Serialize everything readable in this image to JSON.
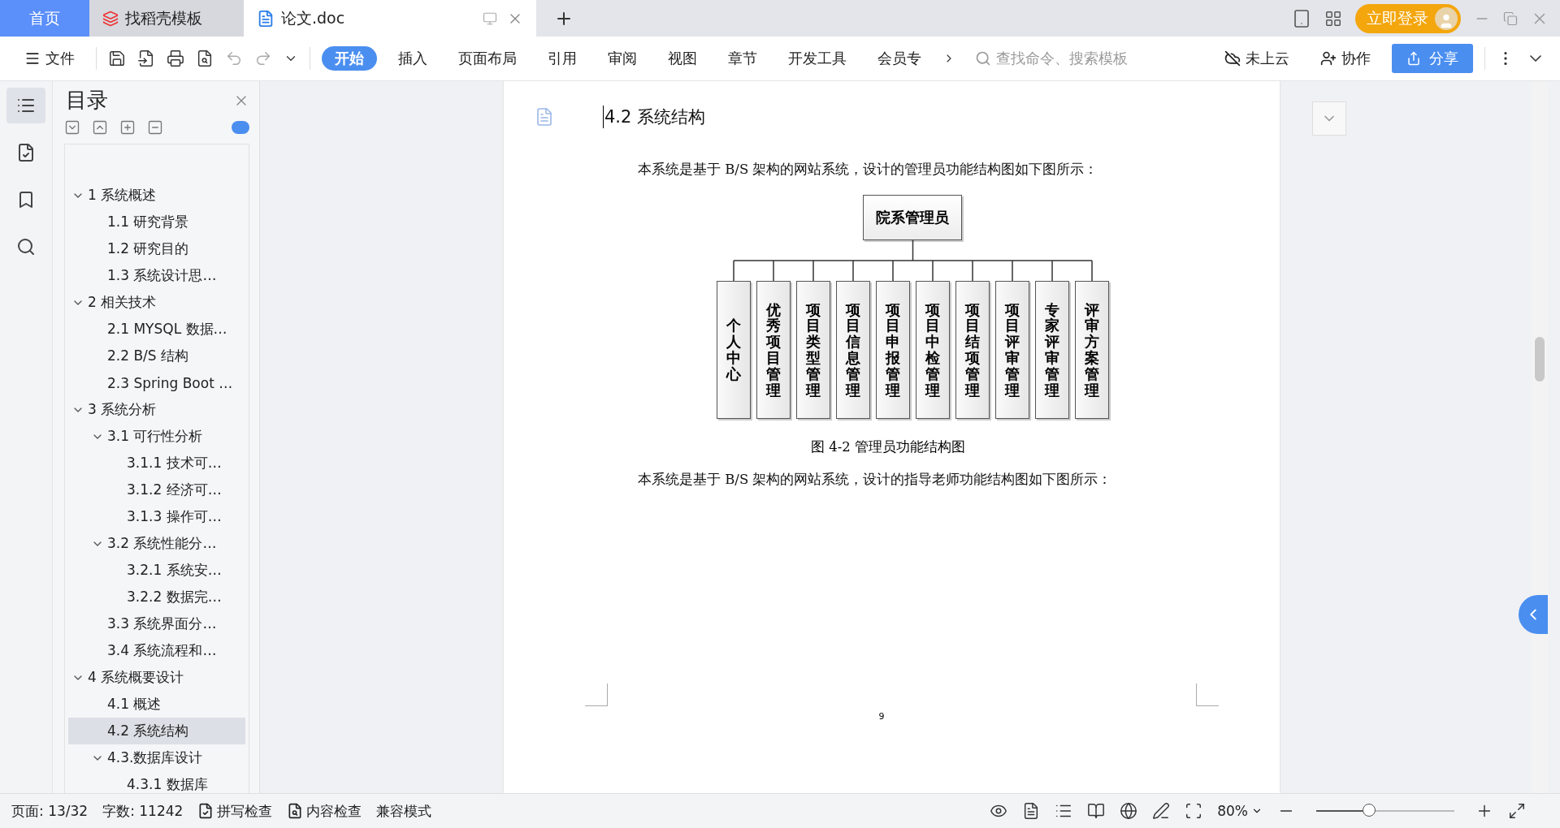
{
  "tabs": [
    {
      "label": "首页",
      "kind": "home",
      "selected": false
    },
    {
      "label": "找稻壳模板",
      "kind": "docer",
      "selected": false
    },
    {
      "label": "论文.doc",
      "kind": "doc",
      "selected": true
    }
  ],
  "login": {
    "label": "立即登录"
  },
  "toolbar": {
    "file": "文件",
    "ribbon": [
      {
        "label": "开始",
        "selected": true
      },
      {
        "label": "插入",
        "selected": false
      },
      {
        "label": "页面布局",
        "selected": false
      },
      {
        "label": "引用",
        "selected": false
      },
      {
        "label": "审阅",
        "selected": false
      },
      {
        "label": "视图",
        "selected": false
      },
      {
        "label": "章节",
        "selected": false
      },
      {
        "label": "开发工具",
        "selected": false
      },
      {
        "label": "会员专",
        "selected": false
      }
    ],
    "search": {
      "placeholder": "查找命令、搜索模板"
    },
    "cloud": "未上云",
    "collab": "协作",
    "share": "分享"
  },
  "sidebar": {
    "title": "目录",
    "items": [
      {
        "label": "1 系统概述",
        "selected": false,
        "expanded": true,
        "children": [
          {
            "label": "1.1  研究背景",
            "selected": false
          },
          {
            "label": "1.2 研究目的",
            "selected": false
          },
          {
            "label": "1.3 系统设计思…",
            "selected": false
          }
        ]
      },
      {
        "label": "2 相关技术",
        "selected": false,
        "expanded": true,
        "children": [
          {
            "label": "2.1 MYSQL 数据…",
            "selected": false
          },
          {
            "label": "2.2 B/S 结构",
            "selected": false
          },
          {
            "label": "2.3 Spring Boot …",
            "selected": false
          }
        ]
      },
      {
        "label": "3 系统分析",
        "selected": false,
        "expanded": true,
        "children": [
          {
            "label": "3.1 可行性分析",
            "selected": false,
            "expanded": true,
            "children": [
              {
                "label": "3.1.1 技术可…",
                "selected": false
              },
              {
                "label": "3.1.2 经济可…",
                "selected": false
              },
              {
                "label": "3.1.3 操作可…",
                "selected": false
              }
            ]
          },
          {
            "label": "3.2 系统性能分…",
            "selected": false,
            "expanded": true,
            "children": [
              {
                "label": "3.2.1  系统安…",
                "selected": false
              },
              {
                "label": "3.2.2  数据完…",
                "selected": false
              }
            ]
          },
          {
            "label": "3.3 系统界面分…",
            "selected": false
          },
          {
            "label": "3.4 系统流程和…",
            "selected": false
          }
        ]
      },
      {
        "label": "4 系统概要设计",
        "selected": false,
        "expanded": true,
        "children": [
          {
            "label": "4.1 概述",
            "selected": false
          },
          {
            "label": "4.2 系统结构",
            "selected": true
          },
          {
            "label": "4.3.数据库设计",
            "selected": false,
            "expanded": true,
            "children": [
              {
                "label": "4.3.1 数据库",
                "selected": false
              }
            ]
          }
        ]
      }
    ]
  },
  "document": {
    "heading": "4.2 系统结构",
    "intro": "本系统是基于 B/S 架构的网站系统，设计的管理员功能结构图如下图所示：",
    "diagram": {
      "root": "院系管理员",
      "children": [
        "个人中心",
        "优秀项目管理",
        "项目类型管理",
        "项目信息管理",
        "项目申报管理",
        "项目中检管理",
        "项目结项管理",
        "项目评审管理",
        "专家评审管理",
        "评审方案管理"
      ]
    },
    "caption": "图 4-2 管理员功能结构图",
    "next": "本系统是基于 B/S 架构的网站系统，设计的指导老师功能结构图如下图所示：",
    "page_number": "9"
  },
  "status_bar": {
    "page": "页面: 13/32",
    "words": "字数: 11242",
    "spell": "拼写检查",
    "content": "内容检查",
    "compat": "兼容模式",
    "zoom": "80%",
    "level": 0.38
  }
}
